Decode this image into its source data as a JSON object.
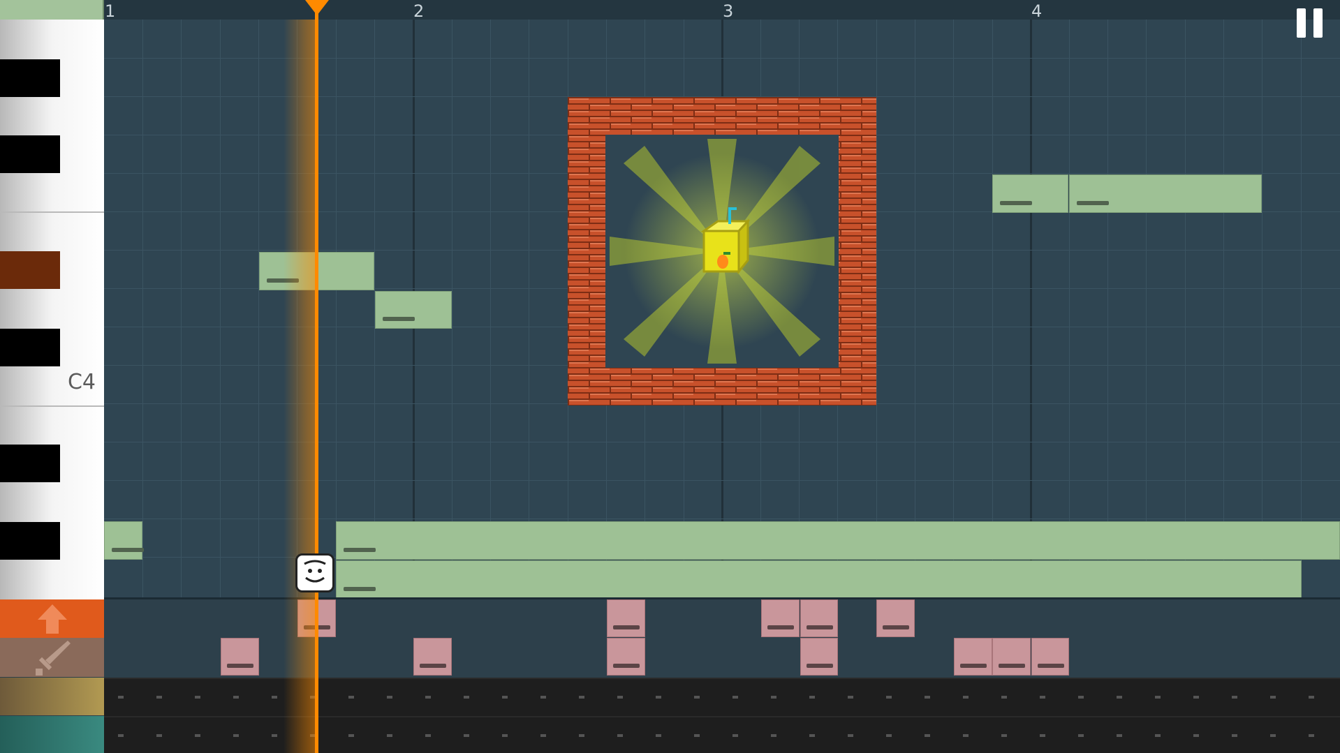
{
  "ruler": {
    "bars": [
      "1",
      "2",
      "3",
      "4"
    ]
  },
  "piano": {
    "octave_label": "C4"
  },
  "controls": {
    "pause_icon": "pause-icon"
  },
  "tools": [
    {
      "name": "jump-arrow-icon",
      "color": "#e05a1c"
    },
    {
      "name": "sword-icon",
      "color": "#8a6a5a"
    },
    {
      "name": "track-color-gold",
      "color": "#9a8448"
    },
    {
      "name": "track-color-teal",
      "color": "#2e7a72"
    }
  ],
  "colors": {
    "grid_bg": "#2f4552",
    "note_green": "#9ec195",
    "note_pink": "#c9969b",
    "playhead": "#ff8a00",
    "brick": "#c8512b",
    "highlight_key": "#6b2a0a"
  },
  "scene": {
    "player_icon": "smiley-face-icon",
    "item_icon": "juice-box-icon",
    "frame_icon": "brick-frame"
  }
}
